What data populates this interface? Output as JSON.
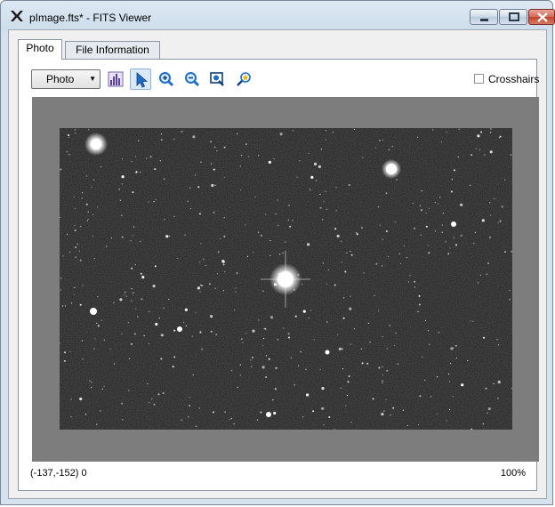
{
  "window": {
    "title": "pImage.fts* - FITS Viewer",
    "app_icon": "x-logo-icon"
  },
  "tabs": [
    {
      "label": "Photo",
      "active": true
    },
    {
      "label": "File Information",
      "active": false
    }
  ],
  "toolbar": {
    "mode_select": {
      "value": "Photo"
    },
    "tools": [
      {
        "name": "histogram-icon",
        "selected": false
      },
      {
        "name": "pointer-icon",
        "selected": true
      },
      {
        "name": "zoom-in-icon",
        "selected": false
      },
      {
        "name": "zoom-out-icon",
        "selected": false
      },
      {
        "name": "zoom-fit-icon",
        "selected": false
      },
      {
        "name": "star-find-icon",
        "selected": false
      }
    ],
    "crosshairs": {
      "label": "Crosshairs",
      "checked": false
    }
  },
  "status": {
    "coords": "(-137,-152) 0",
    "zoom": "100%"
  },
  "colors": {
    "view_background": "#7d7d7d",
    "image_background": "#1e1e1e",
    "accent": "#1e6ec8"
  }
}
